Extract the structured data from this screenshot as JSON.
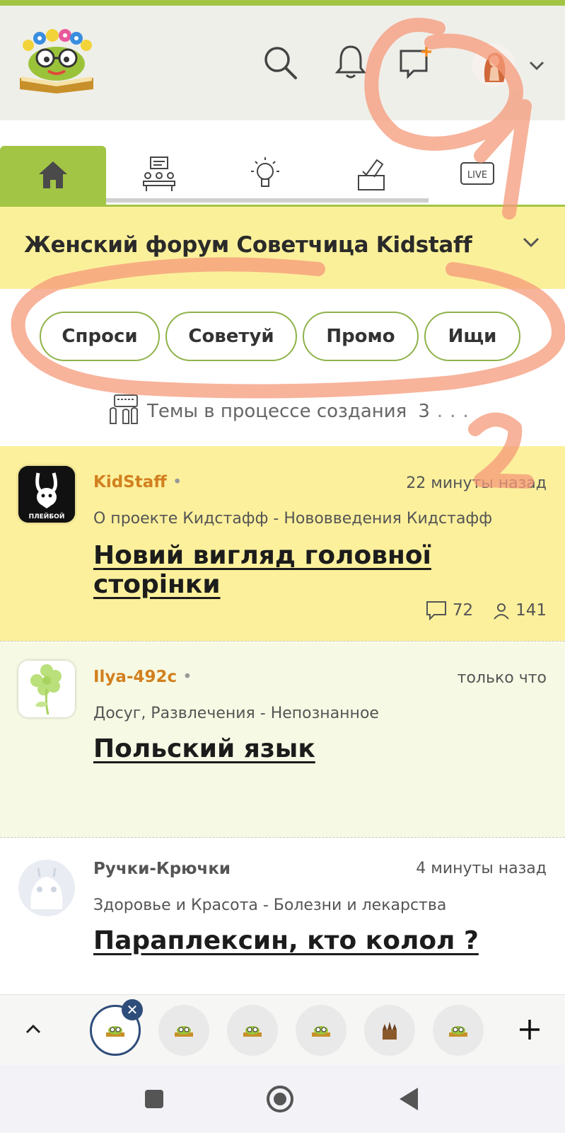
{
  "header": {
    "logo": "kidstaff-logo",
    "icons": [
      "search-icon",
      "bell-icon",
      "new-message-icon",
      "avatar",
      "chevron-down-icon"
    ]
  },
  "tabs": [
    {
      "icon": "home-icon",
      "active": true
    },
    {
      "icon": "meeting-icon",
      "active": false
    },
    {
      "icon": "lightbulb-icon",
      "active": false
    },
    {
      "icon": "vote-icon",
      "active": false
    },
    {
      "icon": "live-icon",
      "label": "LIVE",
      "active": false
    }
  ],
  "forum": {
    "title": "Женский форум Советчица Kidstaff"
  },
  "chips": [
    "Спроси",
    "Советуй",
    "Промо",
    "Ищи"
  ],
  "drafts": {
    "label": "Темы в процессе создания",
    "count": "3",
    "dots": "..."
  },
  "posts": [
    {
      "author": "KidStaff",
      "time": "22 минуты назад",
      "category": "О проекте Кидстафф - Нововведения Кидстафф",
      "title": "Новий вигляд головної сторінки",
      "comments": "72",
      "views": "141",
      "bg": "#fcf09c",
      "avatar_text": "ПЛЕЙБОЙ"
    },
    {
      "author": "Ilya-492c",
      "time": "только что",
      "category": "Досуг, Развлечения - Непознанное",
      "title": "Польский язык",
      "bg": "#f6fae4"
    },
    {
      "author": "Ручки-Крючки",
      "time": "4 минуты назад",
      "category": "Здоровье и Красота - Болезни и лекарства",
      "title": "Параплексин, кто колол ?",
      "bg": "#ffffff"
    }
  ],
  "bottom_bar": {
    "collapse_icon": "chevron-up-icon",
    "add_icon": "plus-icon",
    "close_icon": "close-icon",
    "tab_count": 6
  },
  "annotations": [
    "1",
    "2"
  ],
  "colors": {
    "accent": "#a3c545",
    "author": "#d2801f",
    "annotation": "#f59a7a"
  }
}
